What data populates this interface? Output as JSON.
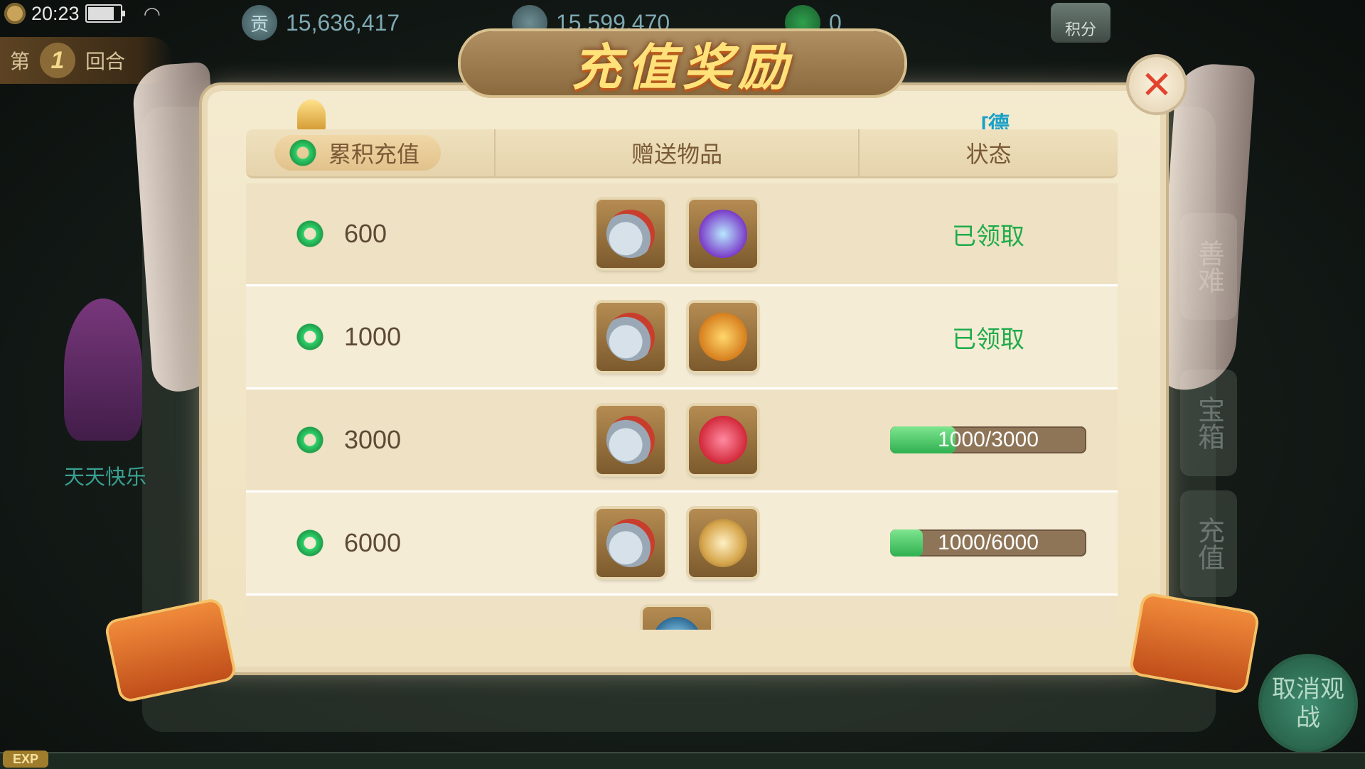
{
  "hud": {
    "time": "20:23",
    "round_prefix": "第",
    "round_number": "1",
    "round_suffix": "回合",
    "currency_1_icon": "贡",
    "currency_1_value": "15,636,417",
    "currency_2_value": "15,599,470",
    "currency_3_value": "0",
    "score_button": "积分",
    "hero_name": "天天快乐",
    "side_button_1": "善难",
    "side_button_2": "宝箱",
    "side_button_3": "充值",
    "cancel_watch": "取消观战",
    "exp_label": "EXP"
  },
  "dialog": {
    "title": "充值奖励",
    "close_glyph": "✕",
    "ticker_text": "[德",
    "headers": {
      "col1": "累积充值",
      "col2": "赠送物品",
      "col3": "状态"
    },
    "rows": [
      {
        "amount": "600",
        "items": [
          "silver-ingots-bag",
          "crystal-orb"
        ],
        "status": "已领取"
      },
      {
        "amount": "1000",
        "items": [
          "silver-ingots-bag",
          "gold-lucky-bag"
        ],
        "status": "已领取"
      },
      {
        "amount": "3000",
        "items": [
          "silver-ingots-bag",
          "red-lucky-bag"
        ],
        "progress_text": "1000/3000",
        "progress": 0.333
      },
      {
        "amount": "6000",
        "items": [
          "silver-ingots-bag",
          "golden-dragon-mount"
        ],
        "progress_text": "1000/6000",
        "progress": 0.167
      },
      {
        "amount": "",
        "items": [
          "jade-claw"
        ],
        "status": ""
      }
    ]
  },
  "colors": {
    "claimed_green": "#1fab4a",
    "progress_fill": "#2fb050",
    "title_gold": "#ffe27a",
    "close_red": "#e2432f"
  }
}
